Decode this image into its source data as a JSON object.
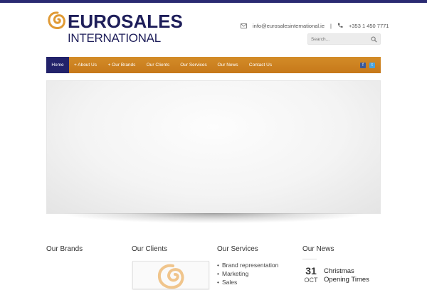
{
  "brand": {
    "line1": "EUROSALES",
    "line2": "INTERNATIONAL",
    "accent": "#e09a35",
    "navy": "#1e1e5a"
  },
  "contact": {
    "email": "info@eurosalesinternational.ie",
    "separator": "|",
    "phone": "+353 1 450 7771",
    "email_icon": "envelope-icon",
    "phone_icon": "phone-icon"
  },
  "search": {
    "placeholder": "Search...",
    "icon": "search-icon"
  },
  "nav": {
    "items": [
      {
        "label": "Home",
        "active": true
      },
      {
        "label": "+ About Us"
      },
      {
        "label": "+ Our Brands"
      },
      {
        "label": "Our Clients"
      },
      {
        "label": "Our Services"
      },
      {
        "label": "Our News"
      },
      {
        "label": "Contact Us"
      }
    ],
    "social": [
      "facebook-icon",
      "twitter-icon"
    ],
    "social_labels": [
      "f",
      "t"
    ],
    "bg": "#cf8424",
    "active_bg": "#22226a"
  },
  "sections": {
    "brands_title": "Our Brands",
    "clients_title": "Our Clients",
    "services_title": "Our Services",
    "news_title": "Our News",
    "services": [
      "Brand representation",
      "Marketing",
      "Sales"
    ],
    "news": {
      "day": "31",
      "month": "OCT",
      "title": "Christmas Opening Times"
    }
  }
}
